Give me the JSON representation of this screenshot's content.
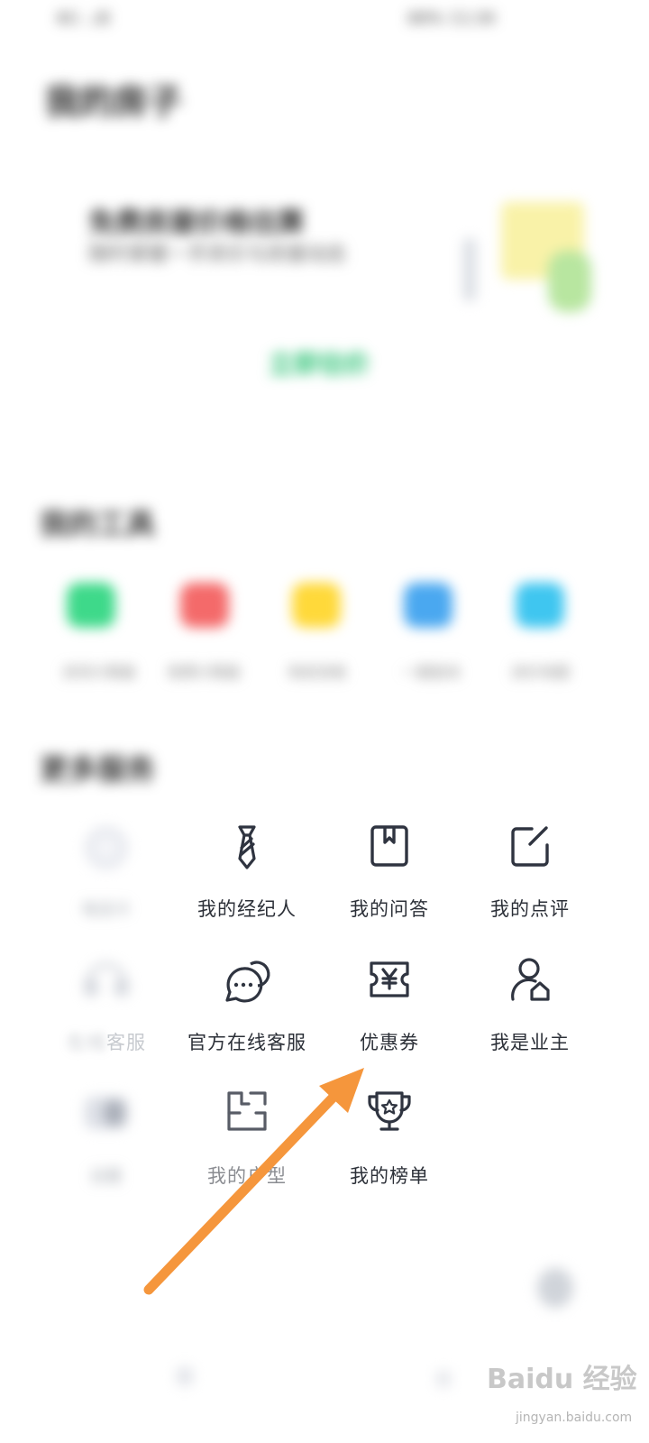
{
  "status_bar": {
    "left": "4G ..ill",
    "right": "88% 12:30"
  },
  "page": {
    "title": "我的房子"
  },
  "banner": {
    "title": "免费房屋价格估算",
    "subtitle": "随时掌握一手房价与房屋动态",
    "button_label": "立即估价"
  },
  "tools_section": {
    "title": "我的工具",
    "items": [
      {
        "label": "房贷计算器",
        "color": "#3ed98a"
      },
      {
        "label": "税费计算器",
        "color": "#f46a6a"
      },
      {
        "label": "购房资格",
        "color": "#ffd93a"
      },
      {
        "label": "一键查询",
        "color": "#4aa8f0"
      },
      {
        "label": "房价地图",
        "color": "#3fc6f0"
      }
    ]
  },
  "services_section": {
    "title": "更多服务",
    "items": [
      {
        "label": "电话卡",
        "icon": "coin-icon",
        "blurred": true
      },
      {
        "label": "我的经纪人",
        "icon": "tie-icon"
      },
      {
        "label": "我的问答",
        "icon": "book-icon"
      },
      {
        "label": "我的点评",
        "icon": "edit-icon"
      },
      {
        "label": "在线客服",
        "icon": "headset-icon",
        "partial_visible": "客服"
      },
      {
        "label": "官方在线客服",
        "icon": "chat-icon"
      },
      {
        "label": "优惠券",
        "icon": "coupon-icon"
      },
      {
        "label": "我是业主",
        "icon": "owner-icon"
      },
      {
        "label": "设置",
        "icon": "toggle-icon",
        "blurred": true
      },
      {
        "label": "我的户型",
        "icon": "floorplan-icon"
      },
      {
        "label": "我的榜单",
        "icon": "trophy-icon"
      }
    ]
  },
  "watermark": {
    "brand": "Baidu 经验",
    "url": "jingyan.baidu.com"
  },
  "colors": {
    "accent": "#26c070",
    "arrow": "#f5963c",
    "icon_stroke": "#2f3440"
  }
}
